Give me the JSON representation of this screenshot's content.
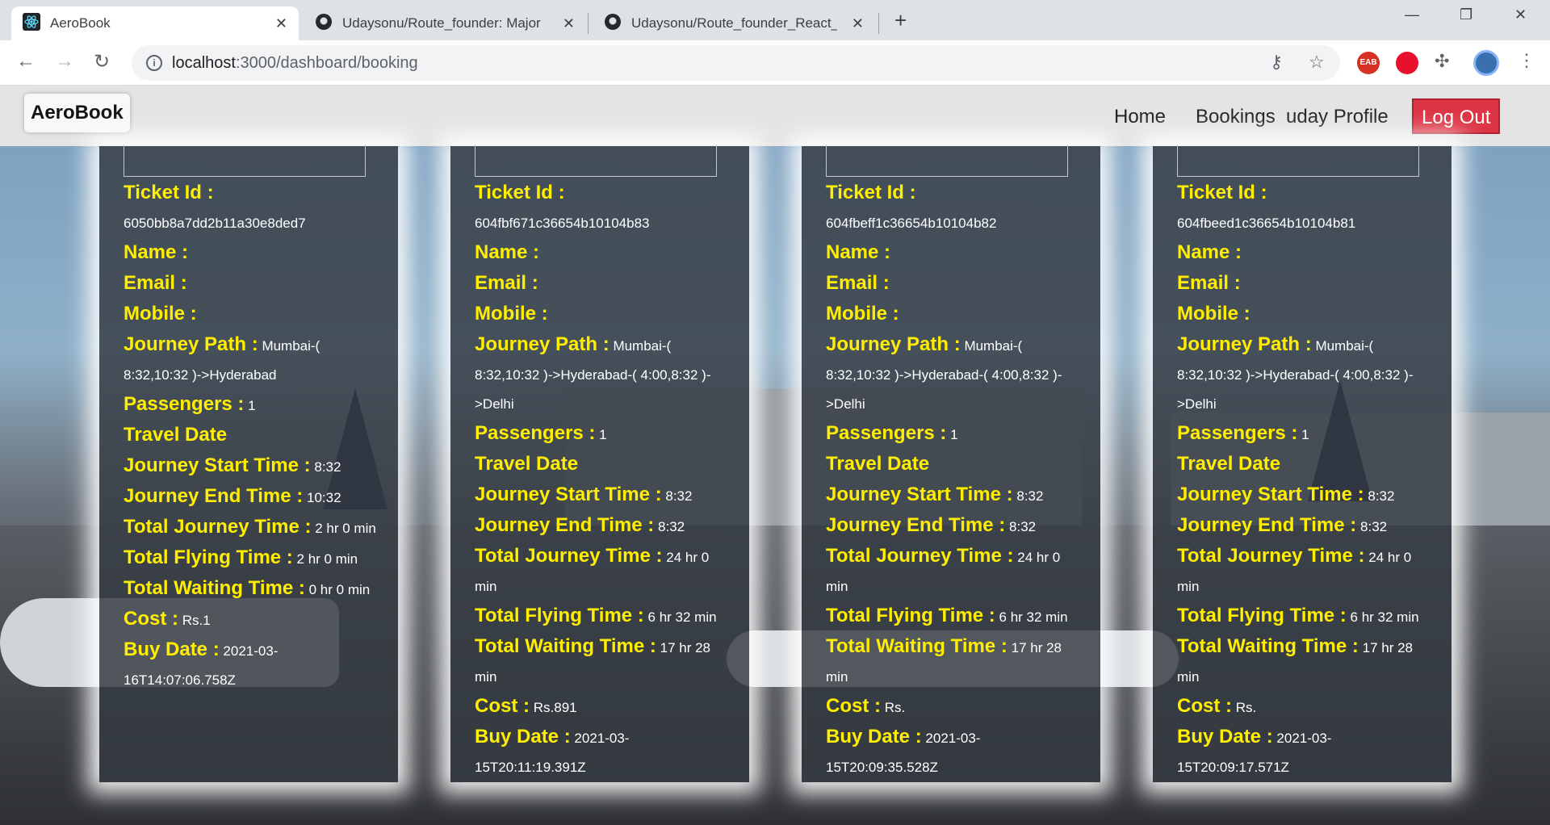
{
  "browser": {
    "tabs": [
      {
        "title": "AeroBook"
      },
      {
        "title": "Udaysonu/Route_founder: Major"
      },
      {
        "title": "Udaysonu/Route_founder_React_"
      }
    ],
    "url_host": "localhost",
    "url_path": ":3000/dashboard/booking",
    "extension_badge": "EAB"
  },
  "app": {
    "brand": "AeroBook",
    "nav": {
      "home": "Home",
      "bookings": "Bookings",
      "profile": "uday Profile",
      "logout": "Log Out"
    }
  },
  "labels": {
    "ticket_id": "Ticket Id :",
    "name": "Name :",
    "email": "Email :",
    "mobile": "Mobile :",
    "journey_path": "Journey Path :",
    "passengers": "Passengers :",
    "travel_date": "Travel Date",
    "start_time": "Journey Start Time :",
    "end_time": "Journey End Time :",
    "total_journey": "Total Journey Time :",
    "total_flying": "Total Flying Time :",
    "total_waiting": "Total Waiting Time :",
    "cost": "Cost :",
    "buy_date": "Buy Date :"
  },
  "bookings": [
    {
      "ticket_id": "6050bb8a7dd2b11a30e8ded7",
      "journey_path": "Mumbai-( 8:32,10:32 )->Hyderabad",
      "passengers": "1",
      "start_time": "8:32",
      "end_time": "10:32",
      "total_journey": "2 hr 0 min",
      "total_flying": "2 hr 0 min",
      "total_waiting": "0 hr 0 min",
      "cost": "Rs.1",
      "buy_date": "2021-03-16T14:07:06.758Z"
    },
    {
      "ticket_id": "604fbf671c36654b10104b83",
      "journey_path": "Mumbai-( 8:32,10:32 )->Hyderabad-( 4:00,8:32 )->Delhi",
      "passengers": "1",
      "start_time": "8:32",
      "end_time": "8:32",
      "total_journey": "24 hr 0 min",
      "total_flying": "6 hr 32 min",
      "total_waiting": "17 hr 28 min",
      "cost": "Rs.891",
      "buy_date": "2021-03-15T20:11:19.391Z"
    },
    {
      "ticket_id": "604fbeff1c36654b10104b82",
      "journey_path": "Mumbai-( 8:32,10:32 )->Hyderabad-( 4:00,8:32 )->Delhi",
      "passengers": "1",
      "start_time": "8:32",
      "end_time": "8:32",
      "total_journey": "24 hr 0 min",
      "total_flying": "6 hr 32 min",
      "total_waiting": "17 hr 28 min",
      "cost": "Rs.",
      "buy_date": "2021-03-15T20:09:35.528Z"
    },
    {
      "ticket_id": "604fbeed1c36654b10104b81",
      "journey_path": "Mumbai-( 8:32,10:32 )->Hyderabad-( 4:00,8:32 )->Delhi",
      "passengers": "1",
      "start_time": "8:32",
      "end_time": "8:32",
      "total_journey": "24 hr 0 min",
      "total_flying": "6 hr 32 min",
      "total_waiting": "17 hr 28 min",
      "cost": "Rs.",
      "buy_date": "2021-03-15T20:09:17.571Z"
    }
  ]
}
